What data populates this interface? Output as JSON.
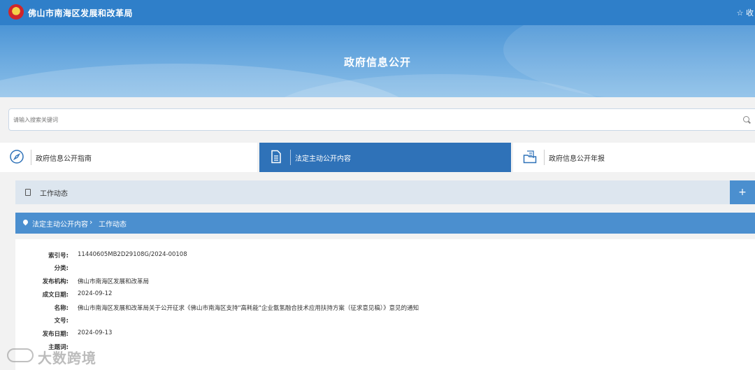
{
  "header": {
    "site_title": "佛山市南海区发展和改革局",
    "favorite_label": "☆ 收"
  },
  "banner": {
    "title": "政府信息公开"
  },
  "search": {
    "placeholder": "请输入搜索关键词"
  },
  "tabs": [
    {
      "label": "政府信息公开指南",
      "icon": "compass-icon",
      "active": false
    },
    {
      "label": "法定主动公开内容",
      "icon": "document-list-icon",
      "active": true
    },
    {
      "label": "政府信息公开年报",
      "icon": "folder-report-icon",
      "active": false
    }
  ],
  "column": {
    "label": "工作动态",
    "expand_label": "+"
  },
  "breadcrumb": {
    "items": [
      "法定主动公开内容",
      "工作动态"
    ],
    "separator": "›"
  },
  "info": {
    "rows": [
      {
        "key": "索引号:",
        "value": "11440605MB2D29108G/2024-00108"
      },
      {
        "key": "分类:",
        "value": ""
      },
      {
        "key": "发布机构:",
        "value": "佛山市南海区发展和改革局"
      },
      {
        "key": "成文日期:",
        "value": "2024-09-12"
      },
      {
        "key": "名称:",
        "value": "佛山市南海区发展和改革局关于公开征求《佛山市南海区支持\"高耗能\"企业氨氢融合技术应用扶持方案（征求意见稿）》意见的通知"
      },
      {
        "key": "文号:",
        "value": ""
      },
      {
        "key": "发布日期:",
        "value": "2024-09-13"
      },
      {
        "key": "主题词:",
        "value": ""
      }
    ]
  },
  "watermark": {
    "text": "大数跨境"
  },
  "colors": {
    "topbar": "#2f7fc9",
    "active_tab": "#2f72b8",
    "breadcrumb": "#4b8fcf",
    "column_bar": "#dde6ef"
  }
}
